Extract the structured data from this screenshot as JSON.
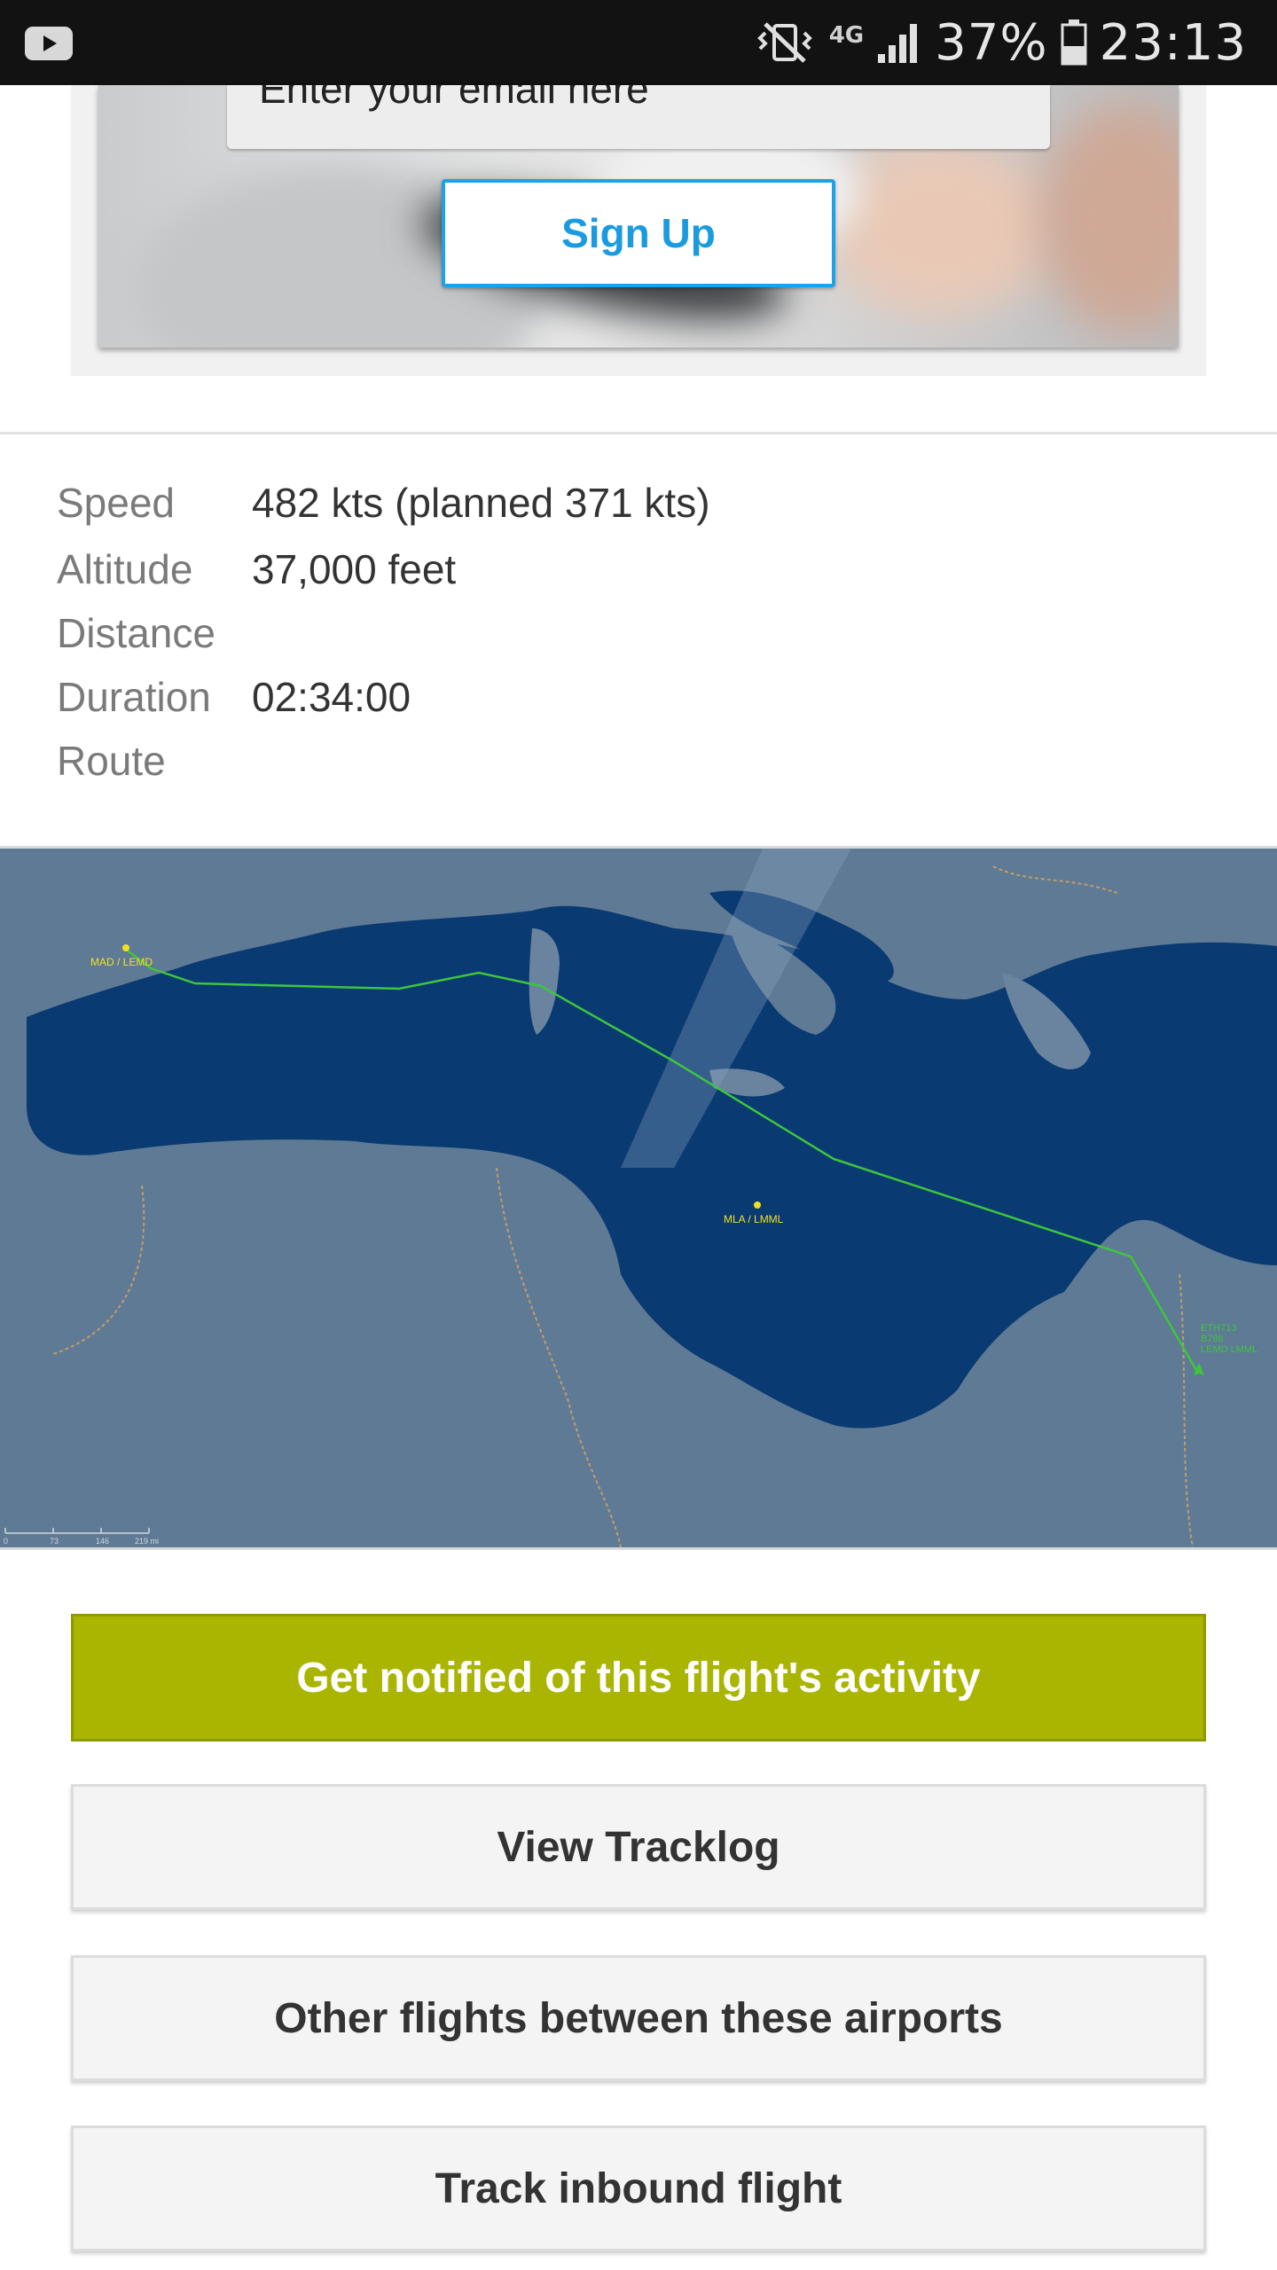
{
  "status_bar": {
    "battery": "37%",
    "time": "23:13",
    "network": "4G",
    "icons": [
      "youtube-icon",
      "vibrate-icon",
      "signal-icon",
      "battery-icon"
    ]
  },
  "signup": {
    "email_placeholder": "Enter your email here",
    "button_label": "Sign Up"
  },
  "details": [
    {
      "label": "Speed",
      "value": "482 kts (planned 371 kts)"
    },
    {
      "label": "Altitude",
      "value": "37,000 feet"
    },
    {
      "label": "Distance",
      "value": ""
    },
    {
      "label": "Duration",
      "value": "02:34:00"
    },
    {
      "label": "Route",
      "value": ""
    }
  ],
  "map": {
    "origin_label": "MAD / LEMD",
    "midpoint_label": "MLA / LMML",
    "flight_label_lines": [
      "ETH713",
      "B788",
      "LEMD LMML"
    ],
    "scale_labels": [
      "0",
      "73",
      "146",
      "219 mi"
    ],
    "route_color": "#3dc63d",
    "label_color": "#f0e020",
    "sea_color": "#0a3a72"
  },
  "actions": {
    "notify": "Get notified of this flight's activity",
    "tracklog": "View Tracklog",
    "other_flights": "Other flights between these airports",
    "inbound": "Track inbound flight"
  },
  "colors": {
    "primary_button": "#a9b500",
    "signup_accent": "#1aa3e8"
  }
}
